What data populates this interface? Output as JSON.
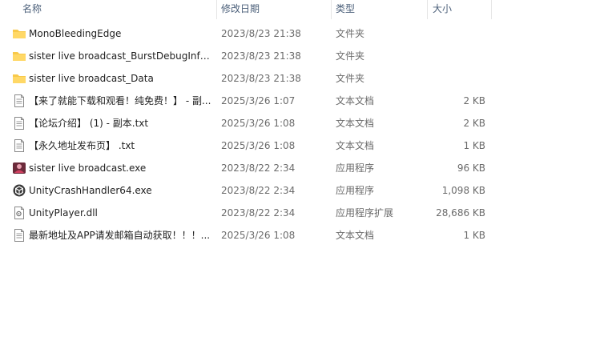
{
  "columns": {
    "name": "名称",
    "date": "修改日期",
    "type": "类型",
    "size": "大小"
  },
  "files": [
    {
      "name": "MonoBleedingEdge",
      "date": "2023/8/23 21:38",
      "type": "文件夹",
      "size": "",
      "icon": "folder-icon"
    },
    {
      "name": "sister live broadcast_BurstDebugInfo...",
      "date": "2023/8/23 21:38",
      "type": "文件夹",
      "size": "",
      "icon": "folder-icon"
    },
    {
      "name": "sister live broadcast_Data",
      "date": "2023/8/23 21:38",
      "type": "文件夹",
      "size": "",
      "icon": "folder-icon"
    },
    {
      "name": "【来了就能下载和观看！纯免费！】 - 副...",
      "date": "2025/3/26 1:07",
      "type": "文本文档",
      "size": "2 KB",
      "icon": "text-file-icon"
    },
    {
      "name": "【论坛介绍】 (1) - 副本.txt",
      "date": "2025/3/26 1:08",
      "type": "文本文档",
      "size": "2 KB",
      "icon": "text-file-icon"
    },
    {
      "name": "【永久地址发布页】 .txt",
      "date": "2025/3/26 1:08",
      "type": "文本文档",
      "size": "1 KB",
      "icon": "text-file-icon"
    },
    {
      "name": "sister live broadcast.exe",
      "date": "2023/8/22 2:34",
      "type": "应用程序",
      "size": "96 KB",
      "icon": "app-exe-icon"
    },
    {
      "name": "UnityCrashHandler64.exe",
      "date": "2023/8/22 2:34",
      "type": "应用程序",
      "size": "1,098 KB",
      "icon": "unity-icon"
    },
    {
      "name": "UnityPlayer.dll",
      "date": "2023/8/22 2:34",
      "type": "应用程序扩展",
      "size": "28,686 KB",
      "icon": "dll-file-icon"
    },
    {
      "name": "最新地址及APP请发邮箱自动获取！！！...",
      "date": "2025/3/26 1:08",
      "type": "文本文档",
      "size": "1 KB",
      "icon": "text-file-icon"
    }
  ]
}
